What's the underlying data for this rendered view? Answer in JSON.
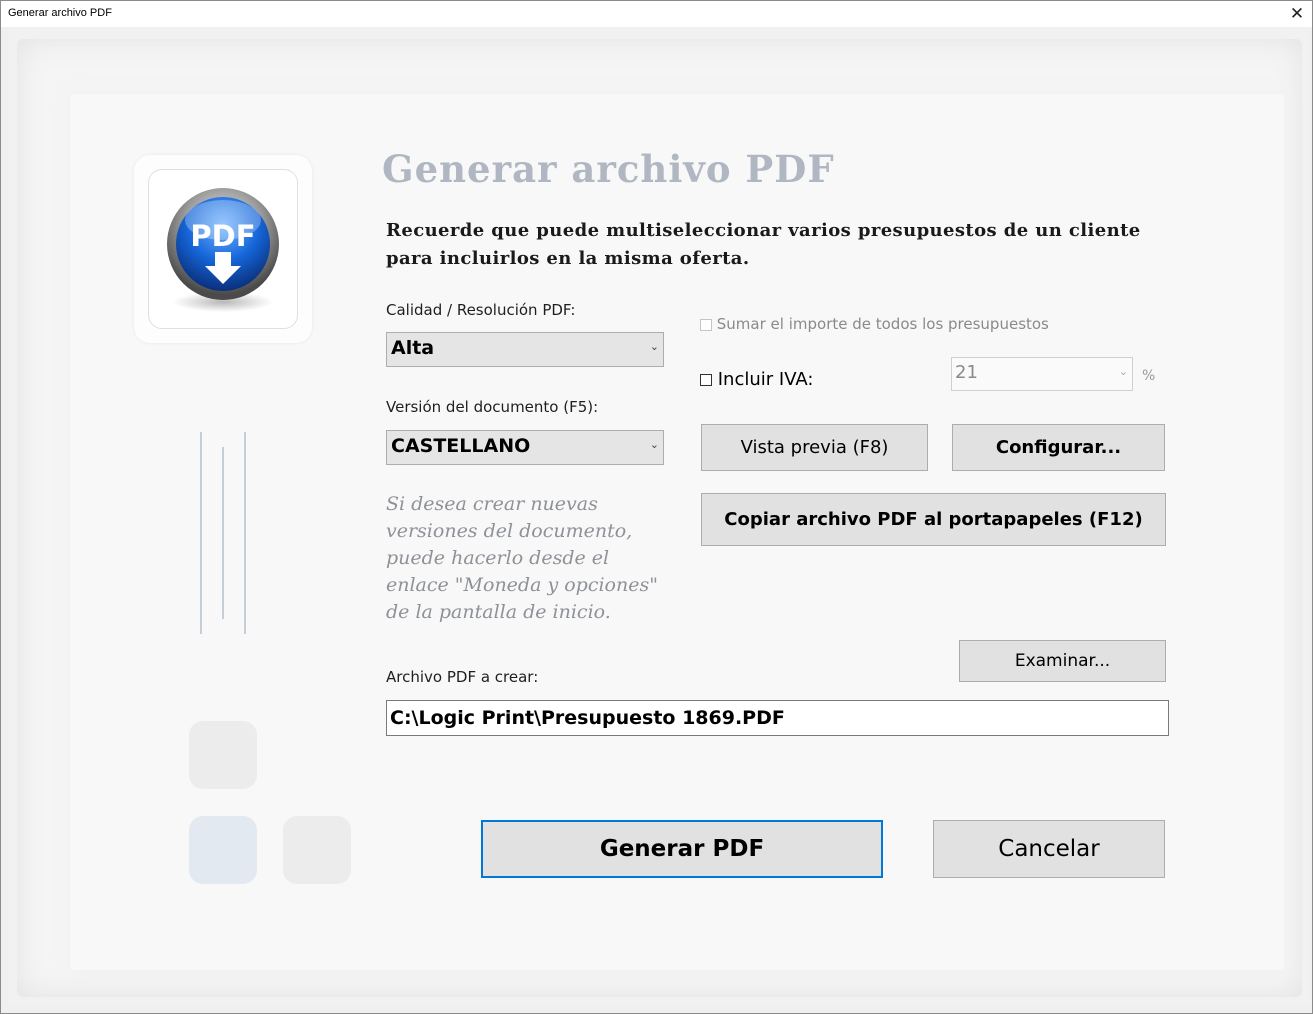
{
  "window": {
    "title": "Generar archivo PDF",
    "close_glyph": "✕"
  },
  "logo": {
    "text": "PDF",
    "icon": "pdf-download-icon"
  },
  "heading": "Generar archivo PDF",
  "notice": "Recuerde que puede multiseleccionar varios presupuestos de un cliente para incluirlos en la misma oferta.",
  "quality": {
    "label": "Calidad / Resolución PDF:",
    "value": "Alta"
  },
  "version": {
    "label": "Versión del documento (F5):",
    "value": "CASTELLANO"
  },
  "version_note": "Si desea crear nuevas versiones del documento, puede hacerlo desde el enlace \"Moneda y opciones\" de la pantalla de inicio.",
  "sum_checkbox": {
    "label": "Sumar el importe de todos los presupuestos",
    "checked": false,
    "enabled": false
  },
  "iva": {
    "label": "Incluir IVA:",
    "checked": false,
    "value": "21",
    "unit": "%"
  },
  "buttons": {
    "preview": "Vista previa (F8)",
    "configure": "Configurar...",
    "copy": "Copiar archivo PDF al portapapeles (F12)",
    "browse": "Examinar...",
    "generate": "Generar PDF",
    "cancel": "Cancelar"
  },
  "output": {
    "label": "Archivo PDF a crear:",
    "value": "C:\\Logic Print\\Presupuesto 1869.PDF"
  },
  "colors": {
    "heading": "#b0b7c2",
    "note": "#8e9197",
    "accent_border": "#0078d7"
  }
}
